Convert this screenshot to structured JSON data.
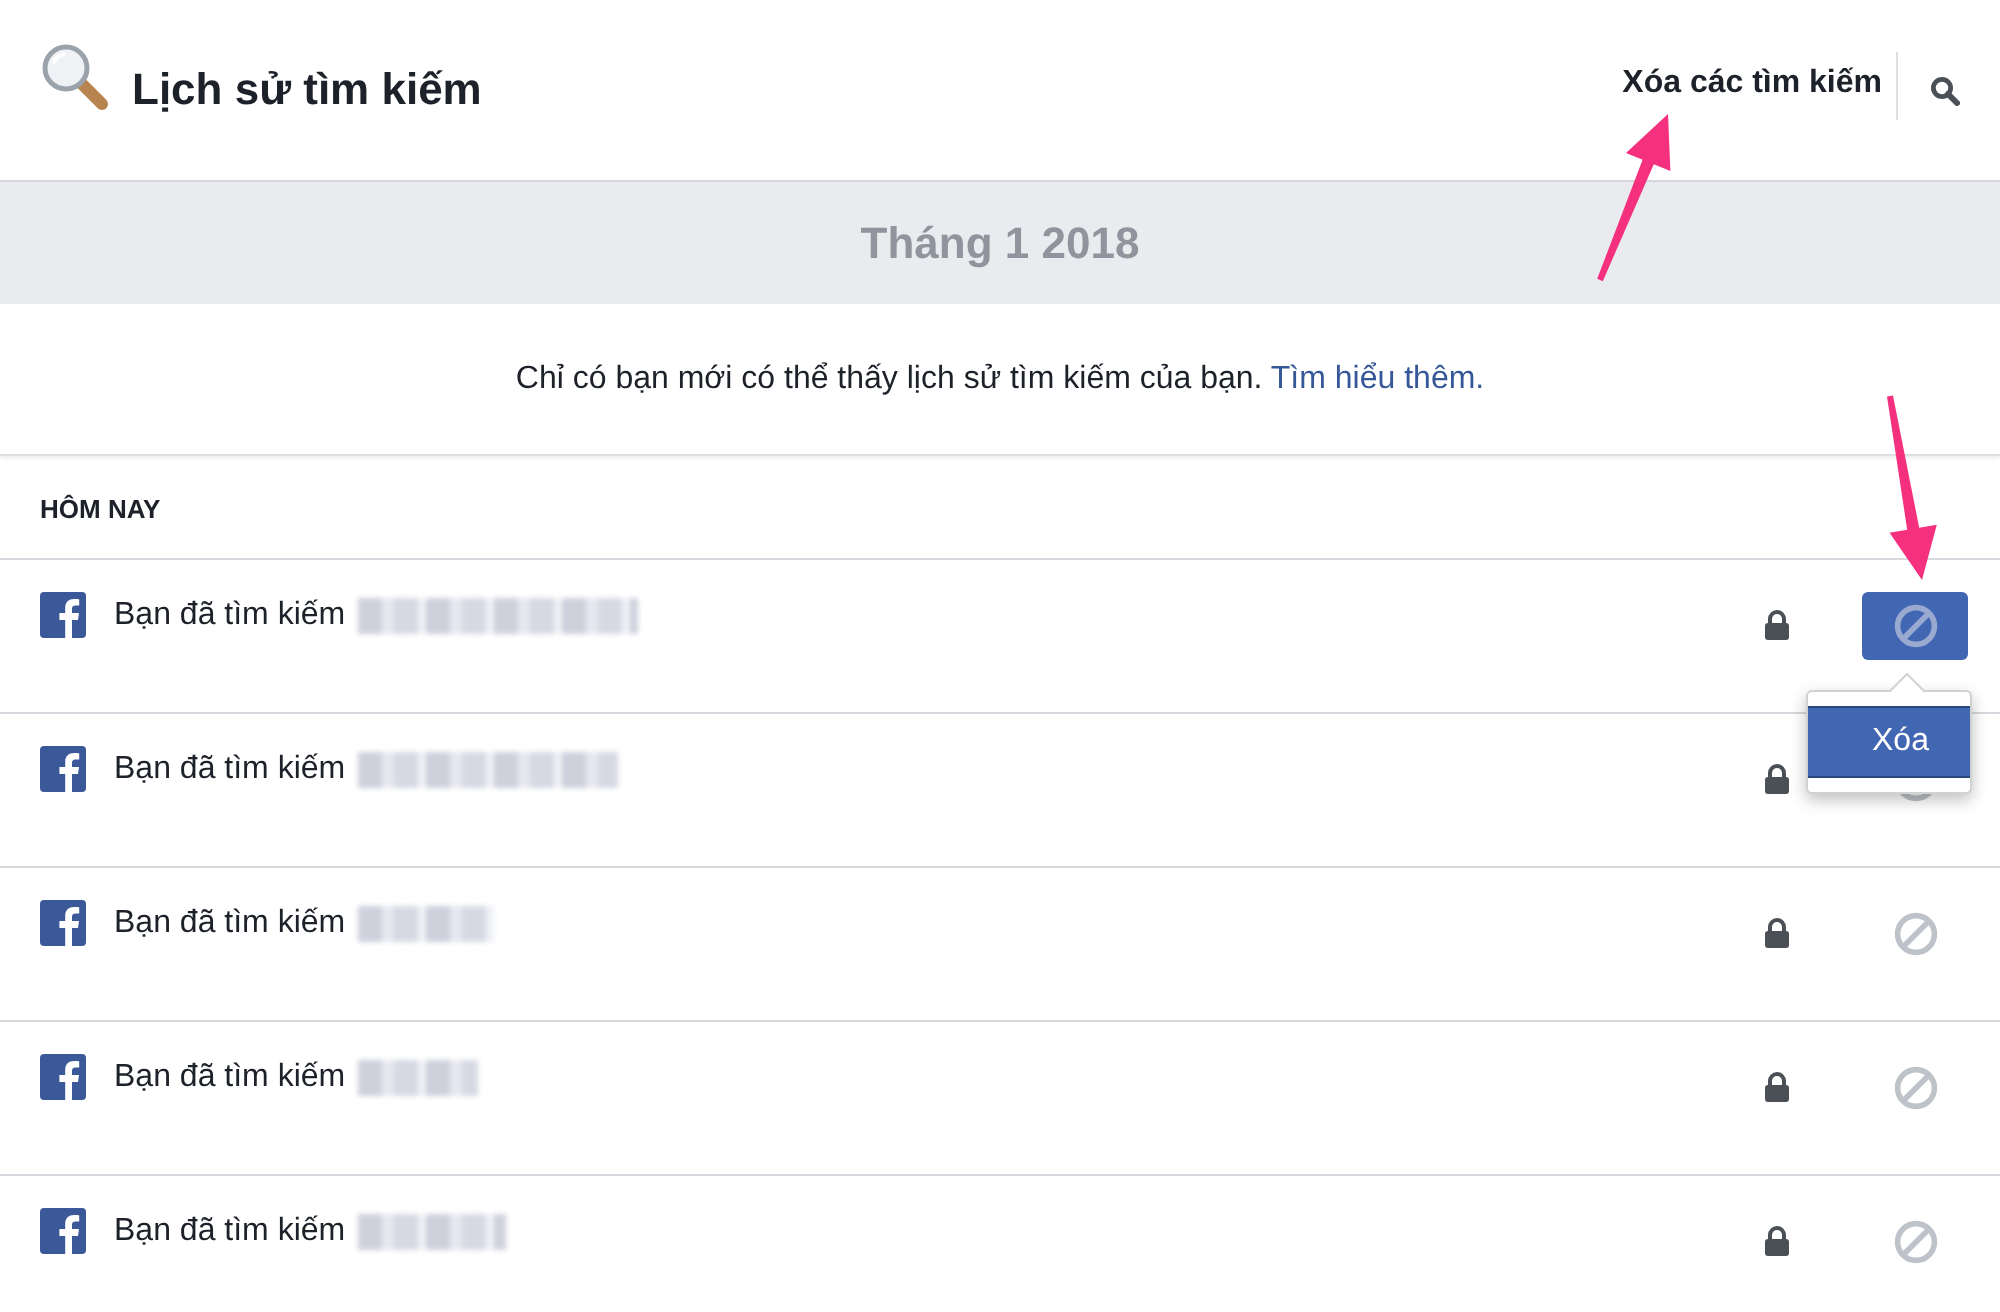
{
  "header": {
    "title": "Lịch sử tìm kiếm",
    "clear_link": "Xóa các tìm kiếm"
  },
  "month": "Tháng 1 2018",
  "notice": {
    "text": "Chỉ có bạn mới có thể thấy lịch sử tìm kiếm của bạn.",
    "link": "Tìm hiểu thêm."
  },
  "section": {
    "label": "HÔM NAY"
  },
  "rows": [
    {
      "text": "Bạn đã tìm kiếm",
      "active": true,
      "menu": [
        {
          "label": "Xóa",
          "selected": true
        }
      ]
    },
    {
      "text": "Bạn đã tìm kiếm",
      "active": false
    },
    {
      "text": "Bạn đã tìm kiếm",
      "active": false
    },
    {
      "text": "Bạn đã tìm kiếm",
      "active": false
    },
    {
      "text": "Bạn đã tìm kiếm",
      "active": false
    }
  ]
}
